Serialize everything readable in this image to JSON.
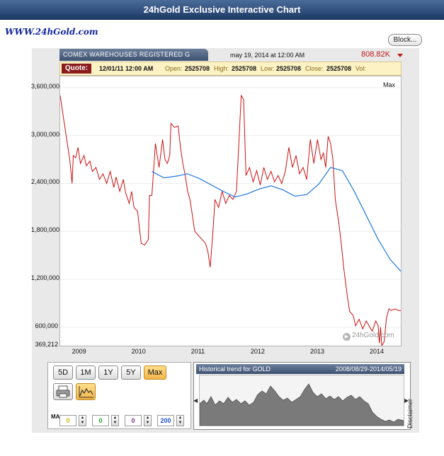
{
  "header": {
    "title": "24hGold Exclusive Interactive Chart"
  },
  "logo_text": "WWW.24hGold.com",
  "block_button": "Block...",
  "series_tab": "COMEX WAREHOUSES REGISTERED G",
  "date_stamp": "may 19, 2014 at 12:00 AM",
  "last_value": "808.82K",
  "quote": {
    "label": "Quote:",
    "datetime": "12/01/11 12:00 AM",
    "open_label": "Open:",
    "open": "2525708",
    "high_label": "High:",
    "high": "2525708",
    "low_label": "Low:",
    "low": "2525708",
    "close_label": "Close:",
    "close": "2525708",
    "vol_label": "Vol:"
  },
  "range_label": "Max",
  "watermark": "24hGold.com",
  "range_buttons": [
    "5D",
    "1M",
    "1Y",
    "5Y",
    "Max"
  ],
  "ma_label": "MA",
  "ma_inputs": [
    "0",
    "0",
    "0",
    "200"
  ],
  "historical": {
    "title": "Historical trend for GOLD",
    "range": "2008/08/29-2014/05/19"
  },
  "disclaimer": "Disclaimer",
  "colors": {
    "series": "#cc1111",
    "moving_average": "#2f7fe0",
    "accent": "#f3b54a"
  },
  "chart_data": {
    "type": "line",
    "title": "COMEX WAREHOUSES REGISTERED G",
    "ytick_labels": [
      "3,600,000",
      "3,000,000",
      "2,400,000",
      "1,800,000",
      "1,200,000",
      "600,000",
      "369,212"
    ],
    "yticks": [
      3600000,
      3000000,
      2400000,
      1800000,
      1200000,
      600000,
      369212
    ],
    "ylim": [
      369212,
      3740000
    ],
    "xtick_labels": [
      "2009",
      "2010",
      "2011",
      "2012",
      "2013",
      "2014"
    ],
    "xticks": [
      2009.0,
      2010.0,
      2011.0,
      2012.0,
      2013.0,
      2014.0
    ],
    "xlim": [
      2008.66,
      2014.38
    ],
    "series": [
      {
        "values": [
          [
            2008.66,
            3500000
          ],
          [
            2008.72,
            3200000
          ],
          [
            2008.78,
            2900000
          ],
          [
            2008.82,
            2700000
          ],
          [
            2008.86,
            2400000
          ],
          [
            2008.88,
            2750000
          ],
          [
            2008.92,
            2720000
          ],
          [
            2008.96,
            2850000
          ],
          [
            2009.0,
            2650000
          ],
          [
            2009.06,
            2750000
          ],
          [
            2009.1,
            2620000
          ],
          [
            2009.16,
            2680000
          ],
          [
            2009.2,
            2550000
          ],
          [
            2009.26,
            2600000
          ],
          [
            2009.32,
            2450000
          ],
          [
            2009.38,
            2520000
          ],
          [
            2009.44,
            2400000
          ],
          [
            2009.5,
            2550000
          ],
          [
            2009.56,
            2350000
          ],
          [
            2009.6,
            2480000
          ],
          [
            2009.66,
            2300000
          ],
          [
            2009.72,
            2450000
          ],
          [
            2009.76,
            2280000
          ],
          [
            2009.82,
            2150000
          ],
          [
            2009.86,
            2300000
          ],
          [
            2009.9,
            2100000
          ],
          [
            2009.96,
            2050000
          ],
          [
            2010.02,
            1650000
          ],
          [
            2010.08,
            1630000
          ],
          [
            2010.14,
            1700000
          ],
          [
            2010.16,
            2250000
          ],
          [
            2010.2,
            2250000
          ],
          [
            2010.26,
            2900000
          ],
          [
            2010.32,
            2600000
          ],
          [
            2010.38,
            2950000
          ],
          [
            2010.42,
            2700000
          ],
          [
            2010.46,
            2650000
          ],
          [
            2010.5,
            2750000
          ],
          [
            2010.52,
            3150000
          ],
          [
            2010.58,
            3100000
          ],
          [
            2010.64,
            3120000
          ],
          [
            2010.68,
            2850000
          ],
          [
            2010.72,
            2650000
          ],
          [
            2010.76,
            2500000
          ],
          [
            2010.8,
            2300000
          ],
          [
            2010.84,
            2200000
          ],
          [
            2010.88,
            2000000
          ],
          [
            2010.92,
            1800000
          ],
          [
            2010.98,
            1750000
          ],
          [
            2011.04,
            1700000
          ],
          [
            2011.1,
            1650000
          ],
          [
            2011.14,
            1550000
          ],
          [
            2011.18,
            1350000
          ],
          [
            2011.22,
            1750000
          ],
          [
            2011.26,
            2200000
          ],
          [
            2011.32,
            2100000
          ],
          [
            2011.38,
            2300000
          ],
          [
            2011.44,
            2150000
          ],
          [
            2011.5,
            2250000
          ],
          [
            2011.56,
            2200000
          ],
          [
            2011.62,
            2300000
          ],
          [
            2011.66,
            2900000
          ],
          [
            2011.7,
            3500000
          ],
          [
            2011.74,
            3450000
          ],
          [
            2011.78,
            2500000
          ],
          [
            2011.84,
            2600000
          ],
          [
            2011.9,
            2420000
          ],
          [
            2011.96,
            2560000
          ],
          [
            2012.02,
            2380000
          ],
          [
            2012.08,
            2600000
          ],
          [
            2012.14,
            2450000
          ],
          [
            2012.2,
            2550000
          ],
          [
            2012.26,
            2420000
          ],
          [
            2012.32,
            2500000
          ],
          [
            2012.38,
            2400000
          ],
          [
            2012.44,
            2550000
          ],
          [
            2012.5,
            2850000
          ],
          [
            2012.56,
            2600000
          ],
          [
            2012.62,
            2750000
          ],
          [
            2012.68,
            2520000
          ],
          [
            2012.74,
            2600000
          ],
          [
            2012.8,
            2450000
          ],
          [
            2012.86,
            2950000
          ],
          [
            2012.92,
            2650000
          ],
          [
            2012.98,
            2950000
          ],
          [
            2013.04,
            2700000
          ],
          [
            2013.08,
            2780000
          ],
          [
            2013.12,
            2600000
          ],
          [
            2013.16,
            2990000
          ],
          [
            2013.2,
            2900000
          ],
          [
            2013.24,
            2700000
          ],
          [
            2013.28,
            2200000
          ],
          [
            2013.34,
            1900000
          ],
          [
            2013.38,
            1650000
          ],
          [
            2013.42,
            1350000
          ],
          [
            2013.48,
            1000000
          ],
          [
            2013.52,
            800000
          ],
          [
            2013.58,
            750000
          ],
          [
            2013.62,
            620000
          ],
          [
            2013.68,
            700000
          ],
          [
            2013.74,
            580000
          ],
          [
            2013.8,
            680000
          ],
          [
            2013.86,
            600000
          ],
          [
            2013.9,
            550000
          ],
          [
            2013.96,
            680000
          ],
          [
            2014.0,
            620000
          ],
          [
            2014.02,
            400000
          ],
          [
            2014.04,
            600000
          ],
          [
            2014.06,
            370000
          ],
          [
            2014.1,
            420000
          ],
          [
            2014.14,
            720000
          ],
          [
            2014.18,
            830000
          ],
          [
            2014.22,
            810000
          ],
          [
            2014.28,
            830000
          ],
          [
            2014.34,
            810000
          ],
          [
            2014.38,
            808820
          ]
        ]
      },
      {
        "values": [
          [
            2010.2,
            2550000
          ],
          [
            2010.4,
            2470000
          ],
          [
            2010.6,
            2490000
          ],
          [
            2010.8,
            2520000
          ],
          [
            2011.0,
            2460000
          ],
          [
            2011.2,
            2380000
          ],
          [
            2011.4,
            2300000
          ],
          [
            2011.6,
            2230000
          ],
          [
            2011.8,
            2270000
          ],
          [
            2012.0,
            2330000
          ],
          [
            2012.2,
            2370000
          ],
          [
            2012.4,
            2320000
          ],
          [
            2012.6,
            2240000
          ],
          [
            2012.8,
            2260000
          ],
          [
            2013.0,
            2390000
          ],
          [
            2013.2,
            2600000
          ],
          [
            2013.4,
            2560000
          ],
          [
            2013.6,
            2300000
          ],
          [
            2013.8,
            2000000
          ],
          [
            2014.0,
            1700000
          ],
          [
            2014.2,
            1450000
          ],
          [
            2014.38,
            1300000
          ]
        ]
      }
    ],
    "grid": true,
    "legend": "none"
  }
}
